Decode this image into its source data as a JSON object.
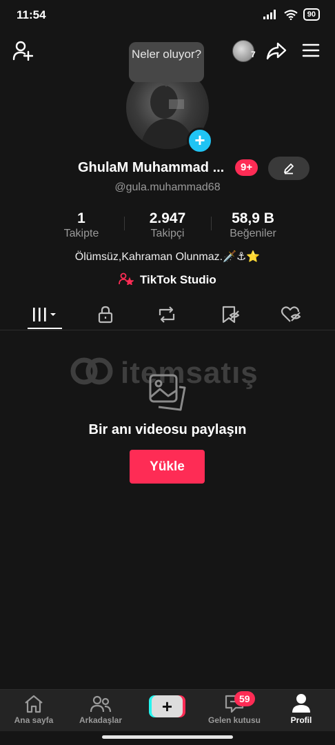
{
  "status": {
    "time": "11:54",
    "battery": "90"
  },
  "top": {
    "avatar_count": "7",
    "bubble_text": "Neler oluyor?"
  },
  "profile": {
    "name": "GhulaM  Muhammad ...",
    "badge": "9+",
    "handle": "@gula.muhammad68",
    "bio": "Ölümsüz,Kahraman Olunmaz.🗡️⚓⭐",
    "studio_label": "TikTok Studio"
  },
  "stats": [
    {
      "value": "1",
      "label": "Takipte"
    },
    {
      "value": "2.947",
      "label": "Takipçi"
    },
    {
      "value": "58,9 B",
      "label": "Beğeniler"
    }
  ],
  "tabs": [
    "videos-grid-icon",
    "lock-icon",
    "repost-icon",
    "favorites-hidden-icon",
    "liked-hidden-icon"
  ],
  "empty_state": {
    "title": "Bir anı videosu paylaşın",
    "button": "Yükle"
  },
  "watermark": {
    "text": "itemsatış"
  },
  "bottom_nav": {
    "home": "Ana sayfa",
    "friends": "Arkadaşlar",
    "inbox": "Gelen kutusu",
    "inbox_badge": "59",
    "profile": "Profil"
  },
  "colors": {
    "accent": "#fe2c55",
    "cyan": "#25f4ee",
    "plus_badge": "#20c4f4",
    "background": "#151515"
  }
}
